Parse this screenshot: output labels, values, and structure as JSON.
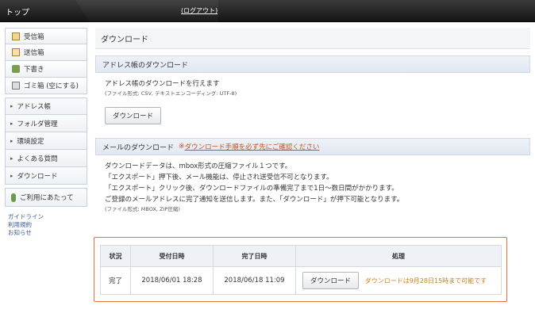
{
  "header": {
    "title": "トップ",
    "logout": "(ログアウト)"
  },
  "sidebar": {
    "mailboxes": [
      {
        "label": "受信箱",
        "icon": "inbox-icon"
      },
      {
        "label": "送信箱",
        "icon": "sent-icon"
      },
      {
        "label": "下書き",
        "icon": "draft-icon"
      },
      {
        "label": "ゴミ箱 (空にする)",
        "icon": "trash-icon"
      }
    ],
    "nav": [
      {
        "label": "アドレス帳"
      },
      {
        "label": "フォルダ管理"
      },
      {
        "label": "環境設定"
      },
      {
        "label": "よくある質問"
      },
      {
        "label": "ダウンロード"
      }
    ],
    "help": "ご利用にあたって",
    "links": [
      "ガイドライン",
      "利用規約",
      "お知らせ"
    ]
  },
  "main": {
    "page_title": "ダウンロード",
    "address": {
      "heading": "アドレス帳のダウンロード",
      "desc": "アドレス帳のダウンロードを行えます",
      "format": "(ファイル形式: CSV, テキストエンコーディング: UTF-8)",
      "button": "ダウンロード"
    },
    "mail": {
      "heading": "メールのダウンロード",
      "notice_mark": "※",
      "notice_link": "ダウンロード手順を必ず先にご確認ください",
      "desc_lines": [
        "ダウンロードデータは、mbox形式の圧縮ファイル１つです。",
        "「エクスポート」押下後、メール機能は、停止され送受信不可となります。",
        "「エクスポート」クリック後、ダウンロードファイルの準備完了まで1日〜数日間がかかります。",
        "ご登録のメールアドレスに完了通知を送信します。また、「ダウンロード」が押下可能となります。"
      ],
      "format": "(ファイル形式: MBOX, ZIP圧縮)"
    },
    "table": {
      "headers": [
        "状況",
        "受付日時",
        "完了日時",
        "処理"
      ],
      "row": {
        "status": "完了",
        "received": "2018/06/01 18:28",
        "completed": "2018/06/18 11:09",
        "button": "ダウンロード",
        "availability": "ダウンロードは9月28日15時まで可能です"
      }
    }
  },
  "colors": {
    "accent_orange": "#e0763a",
    "link_blue": "#3a5b99"
  }
}
